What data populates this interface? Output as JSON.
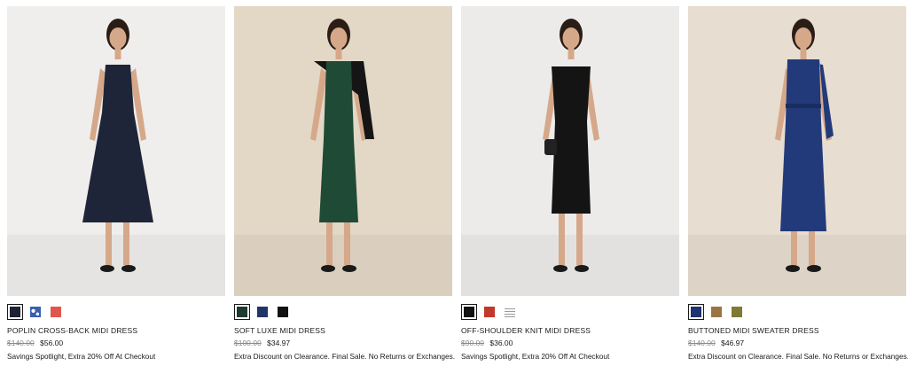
{
  "products": [
    {
      "name": "POPLIN CROSS-BACK MIDI DRESS",
      "original_price": "$140.00",
      "sale_price": "$56.00",
      "promo": "Savings Spotlight, Extra 20% Off At Checkout",
      "swatches": [
        {
          "color": "#1e2436",
          "selected": true,
          "pattern": "solid"
        },
        {
          "color": "#3a5fb0",
          "selected": false,
          "pattern": "print"
        },
        {
          "color": "#e0564c",
          "selected": false,
          "pattern": "solid"
        }
      ],
      "bg": "#efeeec",
      "dress_color": "#1f2538"
    },
    {
      "name": "SOFT LUXE MIDI DRESS",
      "original_price": "$100.00",
      "sale_price": "$34.97",
      "promo": "Extra Discount on Clearance. Final Sale. No Returns or Exchanges.",
      "swatches": [
        {
          "color": "#1d3b2e",
          "selected": true,
          "pattern": "solid"
        },
        {
          "color": "#22356b",
          "selected": false,
          "pattern": "solid"
        },
        {
          "color": "#111111",
          "selected": false,
          "pattern": "solid"
        }
      ],
      "bg": "#e3d7c6",
      "dress_color": "#1f4a35"
    },
    {
      "name": "OFF-SHOULDER KNIT MIDI DRESS",
      "original_price": "$90.00",
      "sale_price": "$36.00",
      "promo": "Savings Spotlight, Extra 20% Off At Checkout",
      "swatches": [
        {
          "color": "#111111",
          "selected": true,
          "pattern": "solid"
        },
        {
          "color": "#c0392b",
          "selected": false,
          "pattern": "solid"
        },
        {
          "color": "#9a9a9a",
          "selected": false,
          "pattern": "stripe"
        }
      ],
      "bg": "#ecebe9",
      "dress_color": "#141414"
    },
    {
      "name": "BUTTONED MIDI SWEATER DRESS",
      "original_price": "$140.00",
      "sale_price": "$46.97",
      "promo": "Extra Discount on Clearance. Final Sale. No Returns or Exchanges.",
      "swatches": [
        {
          "color": "#1f3370",
          "selected": true,
          "pattern": "solid"
        },
        {
          "color": "#9b7444",
          "selected": false,
          "pattern": "solid"
        },
        {
          "color": "#7d7a33",
          "selected": false,
          "pattern": "solid"
        }
      ],
      "bg": "#e7ddd0",
      "dress_color": "#223a7a"
    }
  ]
}
